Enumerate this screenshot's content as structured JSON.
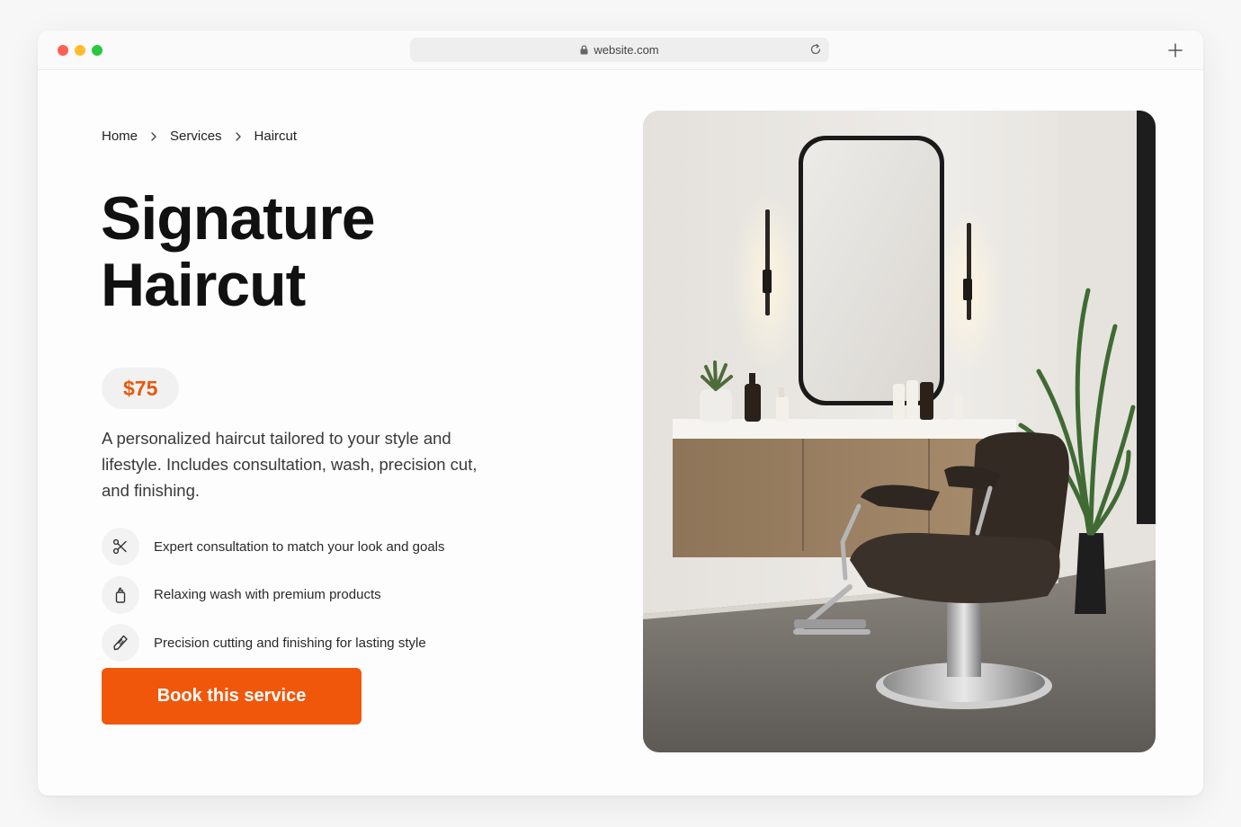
{
  "browser": {
    "url": "website.com"
  },
  "breadcrumb": {
    "items": [
      "Home",
      "Services",
      "Haircut"
    ]
  },
  "service": {
    "title_line1": "Signature",
    "title_line2": "Haircut",
    "price": "$75",
    "description": "A personalized haircut tailored to your style and lifestyle. Includes consultation, wash, precision cut, and finishing."
  },
  "features": [
    {
      "icon": "scissors-icon",
      "text": "Expert consultation to match your look and goals"
    },
    {
      "icon": "bottle-icon",
      "text": "Relaxing wash with premium products"
    },
    {
      "icon": "razor-icon",
      "text": "Precision cutting and finishing for lasting style"
    }
  ],
  "cta": {
    "label": "Book this service"
  },
  "colors": {
    "accent": "#f0570b",
    "price_text": "#e8590c",
    "badge_bg": "#f1f1f1"
  },
  "hero_image": {
    "icon": "salon-interior-photo"
  }
}
